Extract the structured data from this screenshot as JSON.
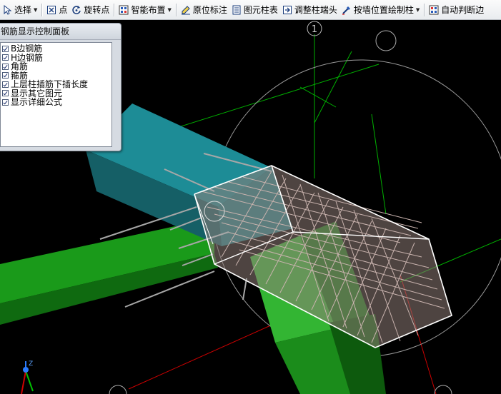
{
  "toolbar": {
    "select_label": "选择",
    "point_label": "点",
    "rotate_point_label": "旋转点",
    "smart_layout_label": "智能布置",
    "origin_annotation_label": "原位标注",
    "element_column_table_label": "图元柱表",
    "adjust_column_end_label": "调整柱端头",
    "draw_by_wall_label": "按墙位置绘制柱",
    "auto_judge_label": "自动判断边",
    "icons": [
      "pointer-icon",
      "point-icon",
      "rotate-icon",
      "smart-layout-icon",
      "annotation-icon",
      "table-icon",
      "adjust-icon",
      "wall-column-icon",
      "auto-judge-icon"
    ]
  },
  "panel": {
    "title": "钢筋显示控制面板",
    "options": [
      {
        "label": "B边钢筋",
        "checked": true
      },
      {
        "label": "H边钢筋",
        "checked": true
      },
      {
        "label": "角筋",
        "checked": true
      },
      {
        "label": "箍筋",
        "checked": true
      },
      {
        "label": "上层柱插筋下插长度",
        "checked": true
      },
      {
        "label": "显示其它图元",
        "checked": true
      },
      {
        "label": "显示详细公式",
        "checked": true
      }
    ]
  },
  "viewport": {
    "axis_label": "1",
    "axis_z_label": "Z",
    "colors": {
      "background": "#000000",
      "beam_green": "#1fa11f",
      "column_teal": "#1a8a94",
      "rebar": "#c9b3ae",
      "axis_green": "#00c000",
      "axis_red": "#d00000",
      "outline": "#ffffff"
    }
  }
}
